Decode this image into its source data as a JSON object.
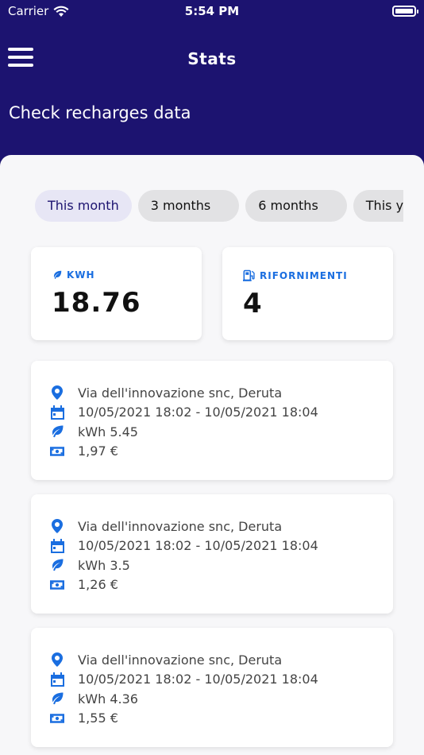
{
  "status_bar": {
    "carrier": "Carrier",
    "time": "5:54 PM"
  },
  "header": {
    "title": "Stats",
    "subtitle": "Check recharges data"
  },
  "filters": {
    "chips": [
      "This month",
      "3 months",
      "6 months",
      "This year"
    ],
    "active_index": 0
  },
  "stats": {
    "kwh": {
      "label": "KWH",
      "value": "18.76"
    },
    "refuels": {
      "label": "RIFORNIMENTI",
      "value": "4"
    }
  },
  "recharges": [
    {
      "location": "Via dell'innovazione snc, Deruta",
      "period": "10/05/2021 18:02 - 10/05/2021 18:04",
      "energy": "kWh 5.45",
      "cost": "1,97 €"
    },
    {
      "location": "Via dell'innovazione snc, Deruta",
      "period": "10/05/2021 18:02 - 10/05/2021 18:04",
      "energy": "kWh 3.5",
      "cost": "1,26 €"
    },
    {
      "location": "Via dell'innovazione snc, Deruta",
      "period": "10/05/2021 18:02 - 10/05/2021 18:04",
      "energy": "kWh 4.36",
      "cost": "1,55 €"
    }
  ],
  "colors": {
    "primary": "#1c1370",
    "accent": "#1a6ee0",
    "background": "#f7f7f9"
  },
  "icons": {
    "menu": "hamburger-icon",
    "location": "map-pin-icon",
    "date": "calendar-icon",
    "energy": "leaf-icon",
    "cost": "banknote-icon",
    "refuel": "fuel-pump-icon"
  }
}
